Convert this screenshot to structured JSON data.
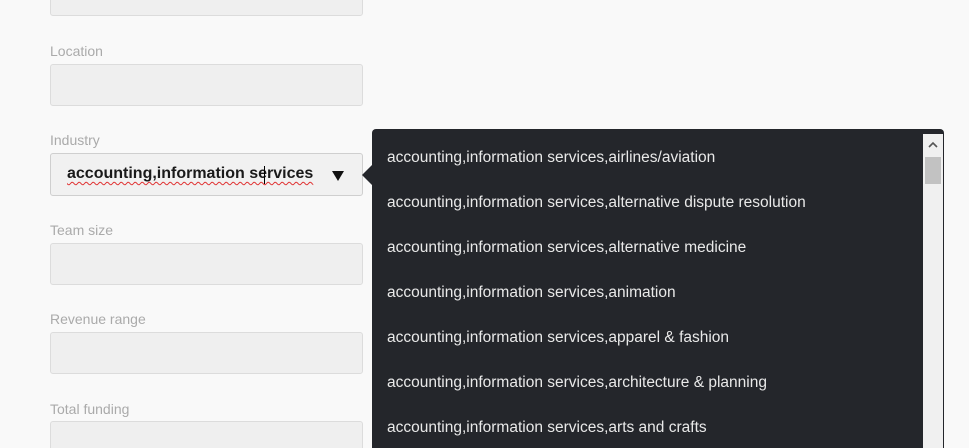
{
  "form": {
    "location_label": "Location",
    "industry_label": "Industry",
    "industry_value": "accounting,information services",
    "team_size_label": "Team size",
    "revenue_range_label": "Revenue range",
    "total_funding_label": "Total funding"
  },
  "dropdown": {
    "options": [
      "accounting,information services,airlines/aviation",
      "accounting,information services,alternative dispute resolution",
      "accounting,information services,alternative medicine",
      "accounting,information services,animation",
      "accounting,information services,apparel & fashion",
      "accounting,information services,architecture & planning",
      "accounting,information services,arts and crafts"
    ]
  },
  "icons": {
    "dropdown_arrow": "triangle-down-icon",
    "scroll_up": "chevron-up-icon"
  },
  "colors": {
    "dropdown_bg": "#24262b",
    "dropdown_text": "#e9e9e9",
    "spellcheck_underline": "#e03030",
    "label": "#aaaaaa"
  }
}
